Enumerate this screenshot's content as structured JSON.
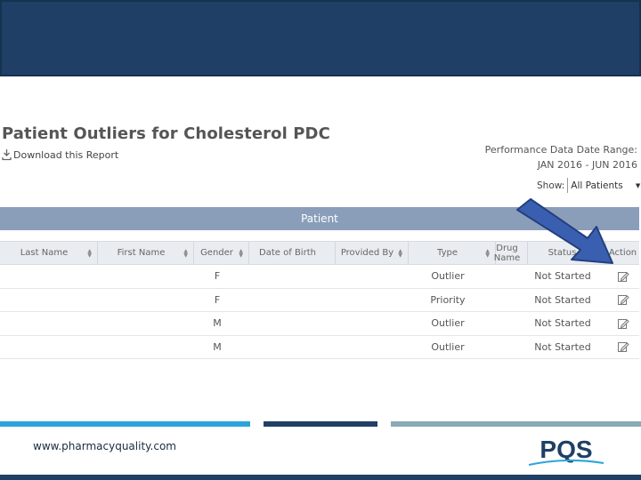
{
  "page": {
    "title": "Patient Outliers for Cholesterol PDC",
    "download_label": "Download this Report",
    "perf_range_label": "Performance Data Date Range:",
    "perf_range_value": "JAN 2016 - JUN 2016",
    "show_label": "Show:",
    "show_selected": "All Patients",
    "section_label": "Patient"
  },
  "table": {
    "headers": [
      "Last Name",
      "First Name",
      "Gender",
      "Date of Birth",
      "Provided By",
      "Type",
      "Drug Name",
      "Status",
      "Action"
    ],
    "rows": [
      {
        "last_name": "",
        "first_name": "",
        "gender": "F",
        "dob": "",
        "provided_by": "",
        "type": "Outlier",
        "drug_name": "",
        "status": "Not Started"
      },
      {
        "last_name": "",
        "first_name": "",
        "gender": "F",
        "dob": "",
        "provided_by": "",
        "type": "Priority",
        "drug_name": "",
        "status": "Not Started"
      },
      {
        "last_name": "",
        "first_name": "",
        "gender": "M",
        "dob": "",
        "provided_by": "",
        "type": "Outlier",
        "drug_name": "",
        "status": "Not Started"
      },
      {
        "last_name": "",
        "first_name": "",
        "gender": "M",
        "dob": "",
        "provided_by": "",
        "type": "Outlier",
        "drug_name": "",
        "status": "Not Started"
      }
    ]
  },
  "footer": {
    "url": "www.pharmacyquality.com",
    "logo_text": "PQS"
  },
  "icons": {
    "download": "download-icon",
    "edit": "edit-icon",
    "sort": "sort-icon",
    "arrow": "arrow-pointer"
  },
  "colors": {
    "banner": "#1f3f66",
    "section_bar": "#8a9eba",
    "arrow": "#3a5fb0",
    "accent_blue": "#2aa5da",
    "accent_gray": "#8aaab7"
  }
}
